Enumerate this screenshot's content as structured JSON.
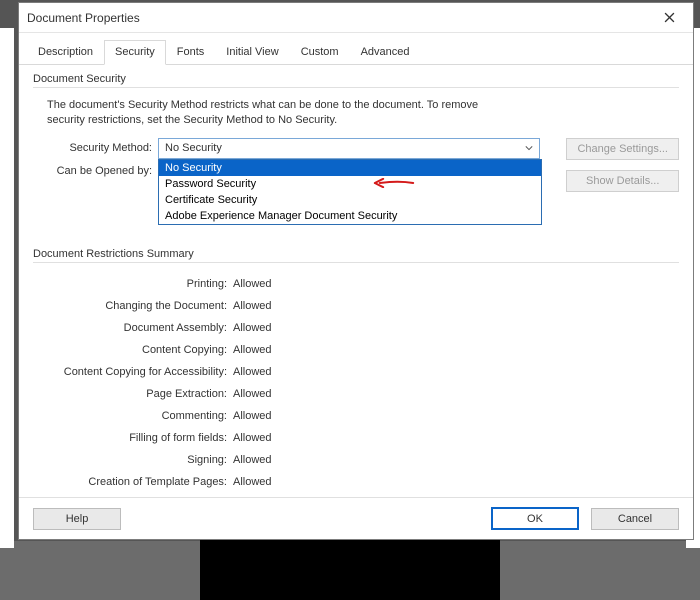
{
  "window": {
    "title": "Document Properties"
  },
  "tabs": [
    "Description",
    "Security",
    "Fonts",
    "Initial View",
    "Custom",
    "Advanced"
  ],
  "activeTab": "Security",
  "docSecurity": {
    "group": "Document Security",
    "desc1": "The document's Security Method restricts what can be done to the document. To remove",
    "desc2": "security restrictions, set the Security Method to No Security.",
    "methodLabel": "Security Method:",
    "methodValue": "No Security",
    "openedLabel": "Can be Opened by:",
    "options": [
      "No Security",
      "Password Security",
      "Certificate Security",
      "Adobe Experience Manager Document Security"
    ],
    "changeBtn": "Change Settings...",
    "detailsBtn": "Show Details..."
  },
  "restrictions": {
    "group": "Document Restrictions Summary",
    "items": [
      {
        "label": "Printing:",
        "value": "Allowed"
      },
      {
        "label": "Changing the Document:",
        "value": "Allowed"
      },
      {
        "label": "Document Assembly:",
        "value": "Allowed"
      },
      {
        "label": "Content Copying:",
        "value": "Allowed"
      },
      {
        "label": "Content Copying for Accessibility:",
        "value": "Allowed"
      },
      {
        "label": "Page Extraction:",
        "value": "Allowed"
      },
      {
        "label": "Commenting:",
        "value": "Allowed"
      },
      {
        "label": "Filling of form fields:",
        "value": "Allowed"
      },
      {
        "label": "Signing:",
        "value": "Allowed"
      },
      {
        "label": "Creation of Template Pages:",
        "value": "Allowed"
      }
    ]
  },
  "footer": {
    "help": "Help",
    "ok": "OK",
    "cancel": "Cancel"
  }
}
